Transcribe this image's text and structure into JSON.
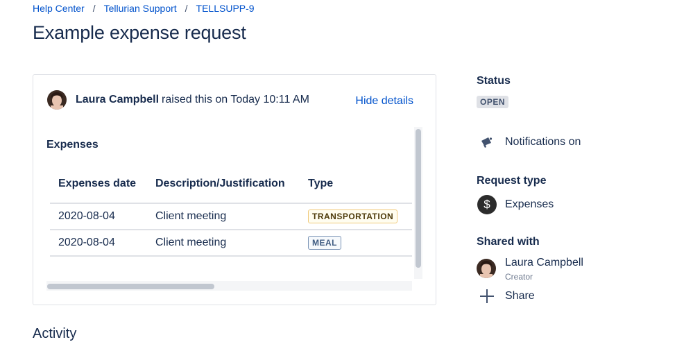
{
  "breadcrumbs": [
    "Help Center",
    "Tellurian Support",
    "TELLSUPP-9"
  ],
  "breadcrumb_separator": "/",
  "page_title": "Example expense request",
  "request": {
    "reporter_name": "Laura Campbell",
    "raised_text": "raised this on Today 10:11 AM",
    "hide_details_label": "Hide details"
  },
  "expenses": {
    "label": "Expenses",
    "columns": [
      "Expenses date",
      "Description/Justification",
      "Type"
    ],
    "rows": [
      {
        "date": "2020-08-04",
        "description": "Client meeting",
        "type": "TRANSPORTATION"
      },
      {
        "date": "2020-08-04",
        "description": "Client meeting",
        "type": "MEAL"
      }
    ]
  },
  "sidebar": {
    "status_heading": "Status",
    "status_value": "OPEN",
    "notifications_label": "Notifications on",
    "request_type_heading": "Request type",
    "request_type_value": "Expenses",
    "shared_with_heading": "Shared with",
    "shared_user_name": "Laura Campbell",
    "shared_user_role": "Creator",
    "share_label": "Share"
  },
  "activity_heading": "Activity",
  "colors": {
    "link": "#0052cc",
    "text": "#172b4d",
    "border": "#dfe1e6"
  },
  "icons": {
    "notifications": "megaphone-icon",
    "request_type": "dollar-icon",
    "share": "plus-icon"
  }
}
